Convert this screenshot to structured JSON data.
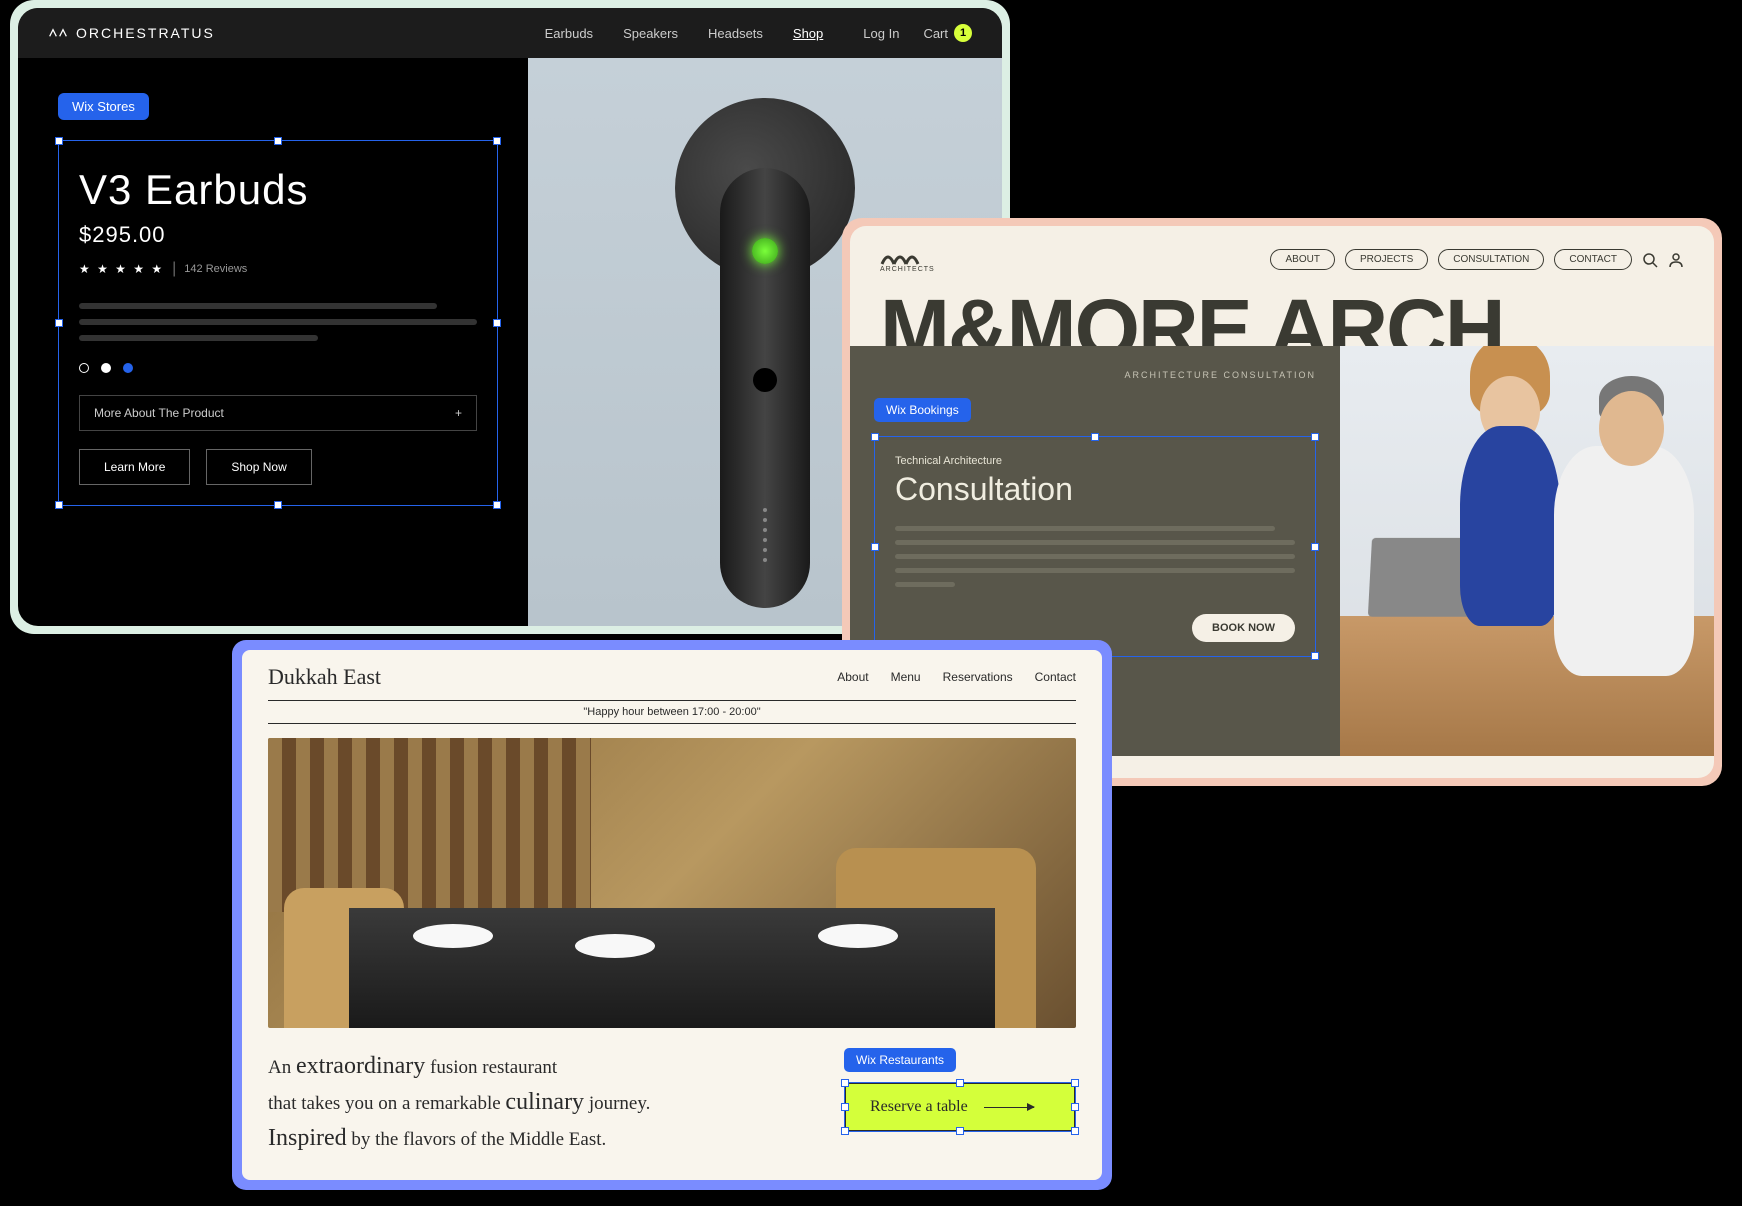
{
  "card1": {
    "brand": "ORCHESTRATUS",
    "nav": [
      "Earbuds",
      "Speakers",
      "Headsets",
      "Shop"
    ],
    "login": "Log In",
    "cart_label": "Cart",
    "cart_count": "1",
    "tag": "Wix Stores",
    "title": "V3 Earbuds",
    "price": "$295.00",
    "reviews": "142 Reviews",
    "accordion": "More About The Product",
    "accordion_icon": "+",
    "btn_learn": "Learn More",
    "btn_shop": "Shop Now"
  },
  "card2": {
    "logo_sub": "ARCHITECTS",
    "nav": [
      "ABOUT",
      "PROJECTS",
      "CONSULTATION",
      "CONTACT"
    ],
    "big_title": "M&MORE ARCH",
    "sublabel": "ARCHITECTURE CONSULTATION",
    "tag": "Wix Bookings",
    "pretitle": "Technical Architecture",
    "title": "Consultation",
    "book": "BOOK NOW"
  },
  "card3": {
    "logo": "Dukkah East",
    "nav": [
      "About",
      "Menu",
      "Reservations",
      "Contact"
    ],
    "banner": "\"Happy hour between 17:00 - 20:00\"",
    "text_1": "An ",
    "text_2": "extraordinary",
    "text_3": " fusion restaurant",
    "text_4": "that takes you on a remarkable ",
    "text_5": "culinary",
    "text_6": " journey.",
    "text_7": "Inspired",
    "text_8": " by the flavors of the Middle East.",
    "tag": "Wix Restaurants",
    "reserve": "Reserve a table"
  }
}
